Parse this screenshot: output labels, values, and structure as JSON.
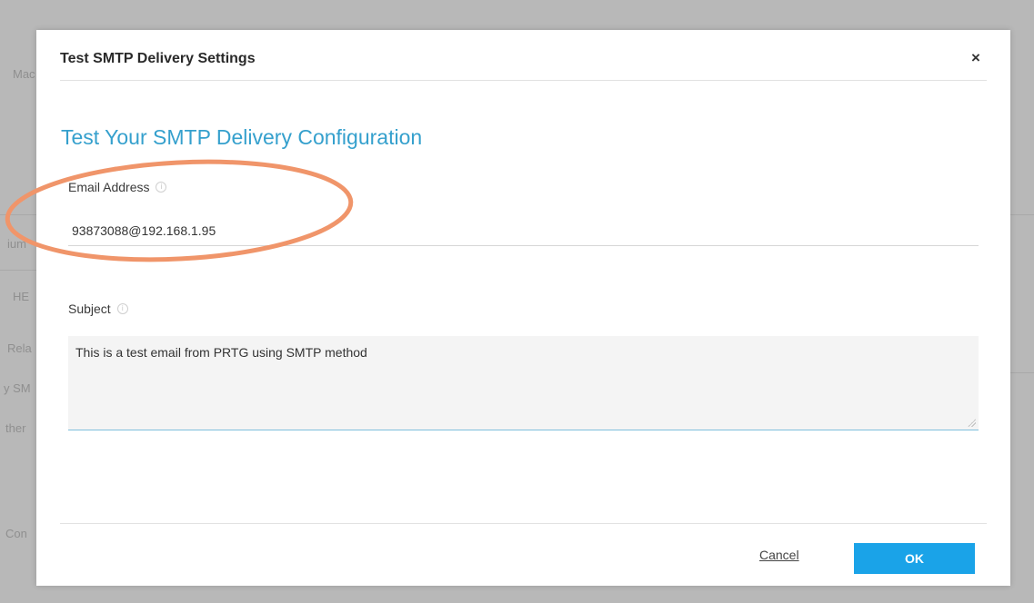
{
  "background": {
    "fragments": [
      "Mac",
      "ium",
      "HE",
      "Rela",
      "y SM",
      "ther",
      "Con"
    ]
  },
  "dialog": {
    "title": "Test SMTP Delivery Settings",
    "close_glyph": "×",
    "heading": "Test Your SMTP Delivery Configuration",
    "email": {
      "label": "Email Address",
      "value": "93873088@192.168.1.95",
      "info_icon": "info-icon"
    },
    "subject": {
      "label": "Subject",
      "value": "This is a test email from PRTG using SMTP method",
      "info_icon": "info-icon"
    },
    "cancel_label": "Cancel",
    "ok_label": "OK"
  },
  "colors": {
    "accent": "#35a0cd",
    "ok_button": "#1aa3e8",
    "highlight": "#f0956a",
    "overlay": "#b8b8b8"
  }
}
